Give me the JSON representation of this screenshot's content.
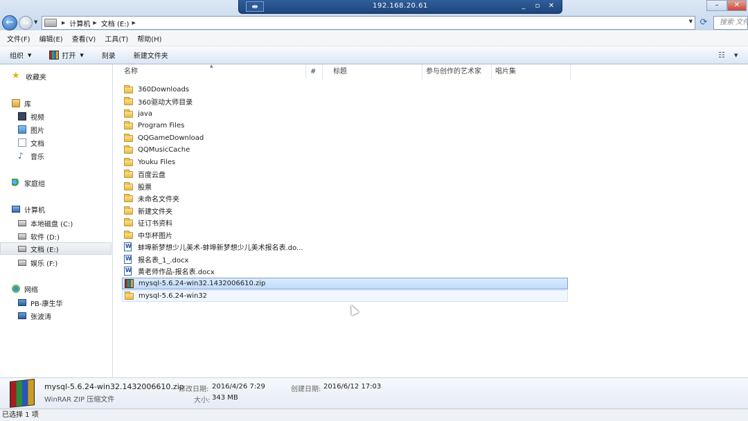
{
  "window": {
    "remote_host": "192.168.20.61",
    "rdp_buttons": [
      "_",
      "▫",
      "✕"
    ]
  },
  "nav": {
    "breadcrumbs": [
      "计算机",
      "文档 (E:)"
    ],
    "search_placeholder": "搜索 文件"
  },
  "menu": [
    "文件(F)",
    "编辑(E)",
    "查看(V)",
    "工具(T)",
    "帮助(H)"
  ],
  "toolbar": {
    "organize": "组织",
    "open": "打开",
    "burn": "刻录",
    "new_folder": "新建文件夹"
  },
  "sidebar": {
    "favorites": "收藏夹",
    "libraries": "库",
    "lib_items": [
      "视频",
      "图片",
      "文档",
      "音乐"
    ],
    "homegroup": "家庭组",
    "computer": "计算机",
    "drives": [
      "本地磁盘 (C:)",
      "软件 (D:)",
      "文档 (E:)",
      "娱乐 (F:)"
    ],
    "network": "网络",
    "network_items": [
      "PB-康生华",
      "张波涛"
    ]
  },
  "columns": [
    "名称",
    "#",
    "标题",
    "参与创作的艺术家",
    "唱片集"
  ],
  "files": [
    {
      "name": "360Downloads",
      "type": "folder"
    },
    {
      "name": "360驱动大师目录",
      "type": "folder"
    },
    {
      "name": "java",
      "type": "folder"
    },
    {
      "name": "Program Files",
      "type": "folder"
    },
    {
      "name": "QQGameDownload",
      "type": "folder"
    },
    {
      "name": "QQMusicCache",
      "type": "folder"
    },
    {
      "name": "Youku Files",
      "type": "folder"
    },
    {
      "name": "百度云盘",
      "type": "folder"
    },
    {
      "name": "股票",
      "type": "folder"
    },
    {
      "name": "未命名文件夹",
      "type": "folder"
    },
    {
      "name": "新建文件夹",
      "type": "folder"
    },
    {
      "name": "征订书资料",
      "type": "folder"
    },
    {
      "name": "中华杯图片",
      "type": "folder"
    },
    {
      "name": "蚌埠新梦想少儿美术-蚌埠新梦想少儿美术报名表.do...",
      "type": "docx"
    },
    {
      "name": "报名表_1_.docx",
      "type": "docx"
    },
    {
      "name": "黄老师作品-报名表.docx",
      "type": "docx"
    },
    {
      "name": "mysql-5.6.24-win32.1432006610.zip",
      "type": "zip",
      "state": "selected"
    },
    {
      "name": "mysql-5.6.24-win32",
      "type": "folder",
      "state": "hover"
    }
  ],
  "details": {
    "name": "mysql-5.6.24-win32.1432006610.zip",
    "type": "WinRAR ZIP 压缩文件",
    "modified_label": "修改日期:",
    "modified": "2016/4/26 7:29",
    "created_label": "创建日期:",
    "created": "2016/6/12 17:03",
    "size_label": "大小:",
    "size": "343 MB"
  },
  "status": "已选择 1 项"
}
